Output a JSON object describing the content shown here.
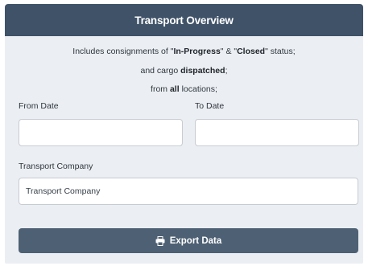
{
  "header": {
    "title": "Transport Overview"
  },
  "info": {
    "line1_a": "Includes consignments of \"",
    "line1_b": "In-Progress",
    "line1_c": "\" & \"",
    "line1_d": "Closed",
    "line1_e": "\" status;",
    "line2_a": "and cargo ",
    "line2_b": "dispatched",
    "line2_c": ";",
    "line3_a": "from ",
    "line3_b": "all",
    "line3_c": " locations;"
  },
  "form": {
    "from_date_label": "From Date",
    "from_date_value": "",
    "to_date_label": "To Date",
    "to_date_value": "",
    "company_label": "Transport Company",
    "company_placeholder": "Transport Company"
  },
  "actions": {
    "export_label": "Export Data",
    "export_icon": "print-icon"
  },
  "colors": {
    "header_bg": "#3f5268",
    "panel_bg": "#ebeef2",
    "button_bg": "#4e6074"
  }
}
